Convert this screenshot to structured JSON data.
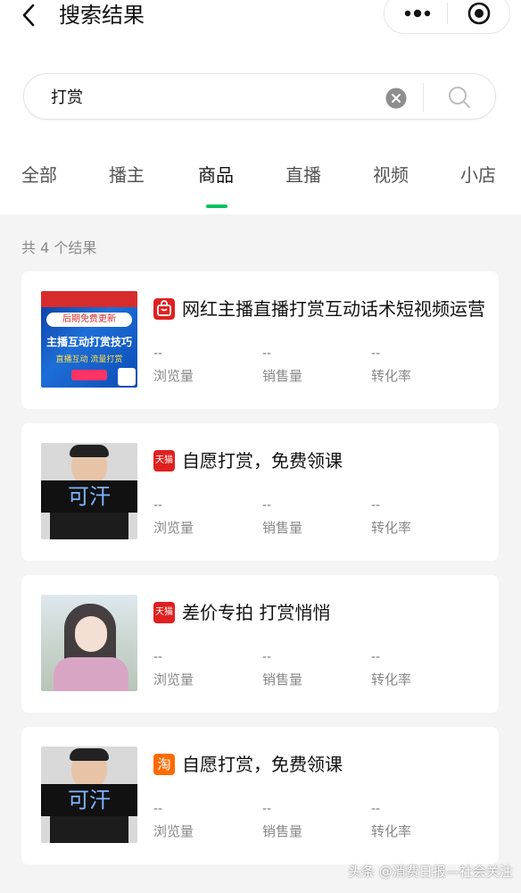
{
  "header": {
    "title": "搜索结果"
  },
  "search": {
    "value": "打赏",
    "placeholder": ""
  },
  "tabs": [
    "全部",
    "播主",
    "商品",
    "直播",
    "视频",
    "小店"
  ],
  "active_tab": "商品",
  "result_count": "共 4 个结果",
  "stat_labels": [
    "浏览量",
    "销售量",
    "转化率"
  ],
  "products": [
    {
      "title": "网红主播直播打赏互动话术短视频运营",
      "store_badge": "tmall-bag",
      "thumb_text": {
        "top": "后期免费更新",
        "main": "主播互动打赏技巧",
        "sub": "直播互动 流量打赏"
      },
      "stats": [
        "--",
        "--",
        "--"
      ]
    },
    {
      "title": "自愿打赏，免费领课",
      "store_badge": "tmall",
      "badge_text": "天猫",
      "thumb_text": {
        "name": "可汗"
      },
      "stats": [
        "--",
        "--",
        "--"
      ]
    },
    {
      "title": "差价专拍 打赏悄悄",
      "store_badge": "tmall",
      "badge_text": "天猫",
      "stats": [
        "--",
        "--",
        "--"
      ]
    },
    {
      "title": "自愿打赏，免费领课",
      "store_badge": "taobao",
      "badge_text": "淘",
      "thumb_text": {
        "name": "可汗"
      },
      "stats": [
        "--",
        "--",
        "--"
      ]
    }
  ],
  "watermark": "头条 @消费日报—社会关注",
  "colors": {
    "accent": "#07c160",
    "tmall": "#e02020",
    "taobao": "#ff6a00"
  }
}
